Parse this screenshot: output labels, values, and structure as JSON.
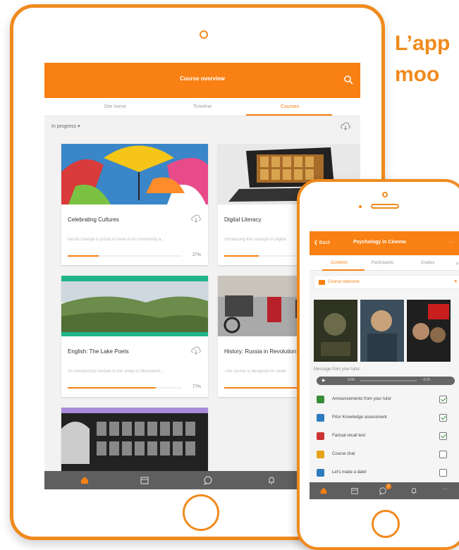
{
  "headline": {
    "line1": "L’app",
    "line2": "moo"
  },
  "tablet": {
    "header_title": "Course overview",
    "tabs": [
      {
        "label": "Site home"
      },
      {
        "label": "Timeline"
      },
      {
        "label": "Courses"
      }
    ],
    "filter_label": "In progress ▾",
    "courses": [
      {
        "title": "Celebrating Cultures",
        "description": "Mount Orange is proud to have in its community a...",
        "progress": 27,
        "progress_label": "27%"
      },
      {
        "title": "Digital Literacy",
        "description": "Introducing the concept of Digital",
        "progress": 30,
        "progress_label": ""
      },
      {
        "title": "English: The Lake Poets",
        "description": "An introductory module to the study of Wordswort...",
        "progress": 77,
        "progress_label": "77%"
      },
      {
        "title": "History: Russia in Revolution",
        "description": "This course is designed for stude",
        "progress": 70,
        "progress_label": ""
      },
      {
        "title": "",
        "description": "",
        "progress": 0,
        "progress_label": ""
      }
    ],
    "bottom_nav": [
      {
        "icon": "home-icon"
      },
      {
        "icon": "calendar-icon"
      },
      {
        "icon": "chat-icon"
      },
      {
        "icon": "bell-icon"
      }
    ]
  },
  "phone": {
    "back_label": "❮ Back",
    "title": "Psychology in Cinema",
    "more_label": "···",
    "tabs": [
      {
        "label": "Contents"
      },
      {
        "label": "Participants"
      },
      {
        "label": "Grades"
      }
    ],
    "section_label": "Course welcome",
    "message_label": "Message from your tutor:",
    "audio": {
      "time": "0:00",
      "remaining": "-0:31"
    },
    "activities": [
      {
        "label": "Announcements from your tutor",
        "done": true,
        "icon": "forum-icon",
        "color": "#3a8d3a"
      },
      {
        "label": "Prior Knowledge assessment",
        "done": true,
        "icon": "question-icon",
        "color": "#2d7bbf"
      },
      {
        "label": "Factual recall test",
        "done": true,
        "icon": "quiz-icon",
        "color": "#c33"
      },
      {
        "label": "Course chat",
        "done": false,
        "icon": "chat-bubble-icon",
        "color": "#e6a21a"
      },
      {
        "label": "Let's make a date!",
        "done": false,
        "icon": "question-icon",
        "color": "#2d7bbf"
      }
    ],
    "chat_badge": "3",
    "bottom_nav": [
      {
        "icon": "home-icon"
      },
      {
        "icon": "calendar-icon"
      },
      {
        "icon": "chat-icon"
      },
      {
        "icon": "bell-icon"
      },
      {
        "icon": "more-icon"
      }
    ]
  },
  "colors": {
    "brand": "#f98012",
    "frame": "#f08a1d",
    "nav": "#5f5f5f"
  }
}
